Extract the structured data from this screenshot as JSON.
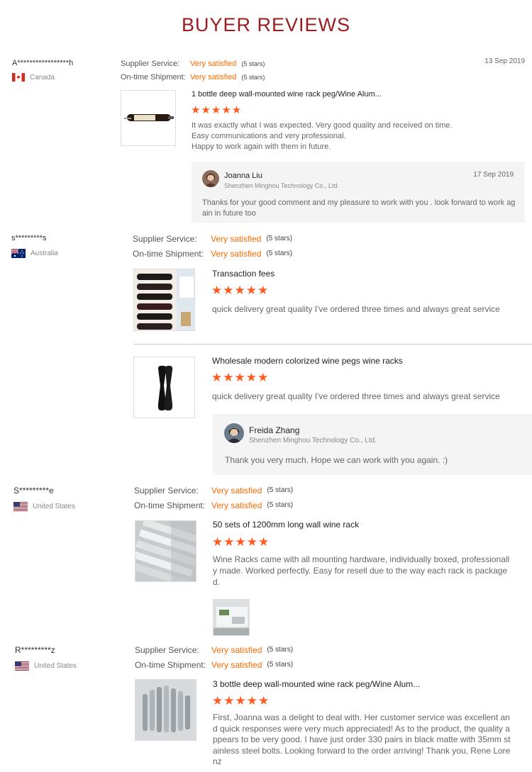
{
  "page": {
    "title": "BUYER REVIEWS"
  },
  "labels": {
    "supplier_service": "Supplier Service:",
    "ontime_shipment": "On-time Shipment:",
    "very_satisfied": "Very satisfied",
    "five_stars": "(5 stars)",
    "star_glyphs": "★★★★★"
  },
  "reviews": [
    {
      "buyer": "A*****************h",
      "country": "Canada",
      "date": "13 Sep 2019",
      "products": [
        {
          "title": "1 bottle deep wall-mounted wine rack peg/Wine Alum...",
          "text_lines": [
            "It was exactly what I was expected. Very good quality and received on time.",
            "Easy communications and very professional.",
            "Happy to work again with them in future."
          ]
        }
      ],
      "reply": {
        "name": "Joanna Liu",
        "company": "Shenzhen Minghou Technology Co., Ltd.",
        "date": "17 Sep 2019",
        "text_lines": [
          "Thanks for your good comment and my pleasure to work with you . look forward to work ag",
          "ain in future too"
        ]
      }
    },
    {
      "buyer": "s*********s",
      "country": "Australia",
      "products": [
        {
          "title": "Transaction fees",
          "text_lines": [
            "quick delivery great quality I've ordered three times and always great service"
          ]
        },
        {
          "title": "Wholesale modern colorized wine pegs wine racks",
          "text_lines": [
            "quick delivery great quality I've ordered three times and always great service"
          ]
        }
      ],
      "reply": {
        "name": "Freida Zhang",
        "company": "Shenzhen Minghou Technology Co., Ltd.",
        "text_lines": [
          "Thank you very much. Hope we can work with you again. :)"
        ]
      }
    },
    {
      "buyer": "S*********e",
      "country": "United States",
      "products": [
        {
          "title": "50 sets of 1200mm long wall wine rack",
          "text_lines": [
            "Wine Racks came with all mounting hardware, individually boxed, professionall",
            "y made. Worked perfectly.  Easy for resell due to the way each rack is package",
            "d."
          ]
        }
      ]
    },
    {
      "buyer": "R*********z",
      "country": "United States",
      "products": [
        {
          "title": "3 bottle deep wall-mounted wine rack peg/Wine Alum...",
          "text_lines": [
            "First, Joanna was a delight to deal with. Her customer service was excellent an",
            "d quick responses were very much appreciated! As to the product, the quality a",
            "ppears to be very good. I have just order 330 pairs in black matte with 35mm st",
            "ainless steel bolts. Looking forward to the order arriving! Thank you, Rene Lore",
            "nz"
          ]
        }
      ]
    }
  ]
}
